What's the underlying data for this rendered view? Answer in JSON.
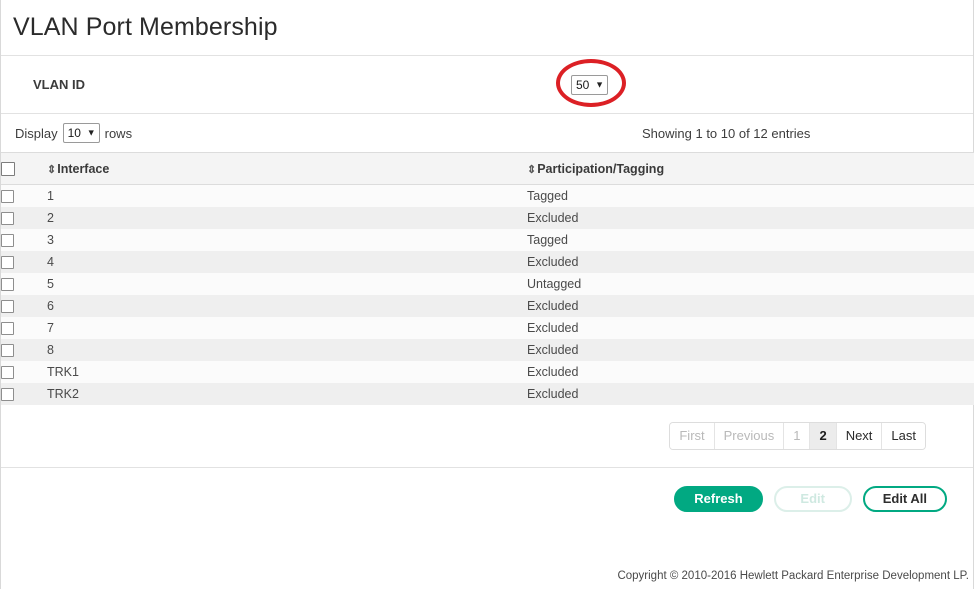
{
  "header": {
    "title": "VLAN Port Membership"
  },
  "vlan_filter": {
    "label": "VLAN ID",
    "selected": "50",
    "caret": "chevron-down-icon",
    "annotation_color": "#dc2025"
  },
  "table_controls": {
    "display_prefix": "Display",
    "rows_value": "10",
    "display_suffix": "rows",
    "showing": "Showing 1 to 10 of 12 entries"
  },
  "table": {
    "sort_icon": "⇕",
    "columns": [
      {
        "key": "select",
        "label": ""
      },
      {
        "key": "interface",
        "label": "Interface"
      },
      {
        "key": "participation",
        "label": "Participation/Tagging"
      }
    ],
    "rows": [
      {
        "interface": "1",
        "participation": "Tagged"
      },
      {
        "interface": "2",
        "participation": "Excluded"
      },
      {
        "interface": "3",
        "participation": "Tagged"
      },
      {
        "interface": "4",
        "participation": "Excluded"
      },
      {
        "interface": "5",
        "participation": "Untagged"
      },
      {
        "interface": "6",
        "participation": "Excluded"
      },
      {
        "interface": "7",
        "participation": "Excluded"
      },
      {
        "interface": "8",
        "participation": "Excluded"
      },
      {
        "interface": "TRK1",
        "participation": "Excluded"
      },
      {
        "interface": "TRK2",
        "participation": "Excluded"
      }
    ]
  },
  "pagination": {
    "first": "First",
    "previous": "Previous",
    "page_1": "1",
    "page_2": "2",
    "next": "Next",
    "last": "Last",
    "active_page": "2"
  },
  "actions": {
    "refresh": "Refresh",
    "edit": "Edit",
    "edit_all": "Edit All",
    "primary_color": "#01a982"
  },
  "footer": {
    "copyright": "Copyright © 2010-2016 Hewlett Packard Enterprise Development LP."
  }
}
